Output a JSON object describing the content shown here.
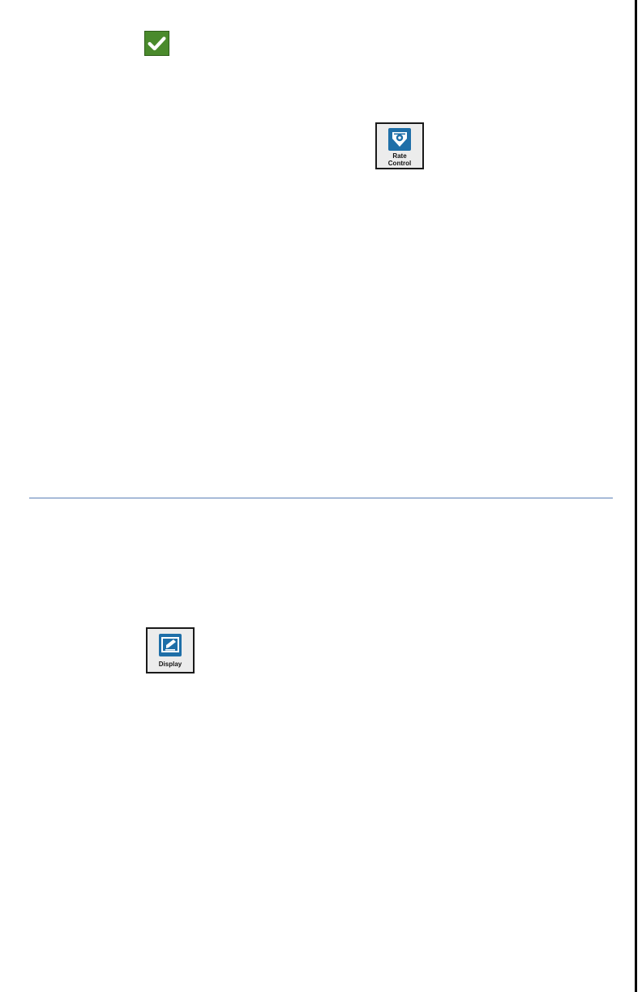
{
  "page": {
    "icons": {
      "check": "checkmark-icon",
      "rate_control": "rate-control-icon",
      "display": "display-icon"
    },
    "colors": {
      "check_green": "#4a8a2c",
      "icon_blue": "#1f6fa8",
      "rule_blue": "#5b7fb6"
    }
  },
  "buttons": {
    "rate_control_label": "Rate\nControl",
    "display_label": "Display"
  }
}
